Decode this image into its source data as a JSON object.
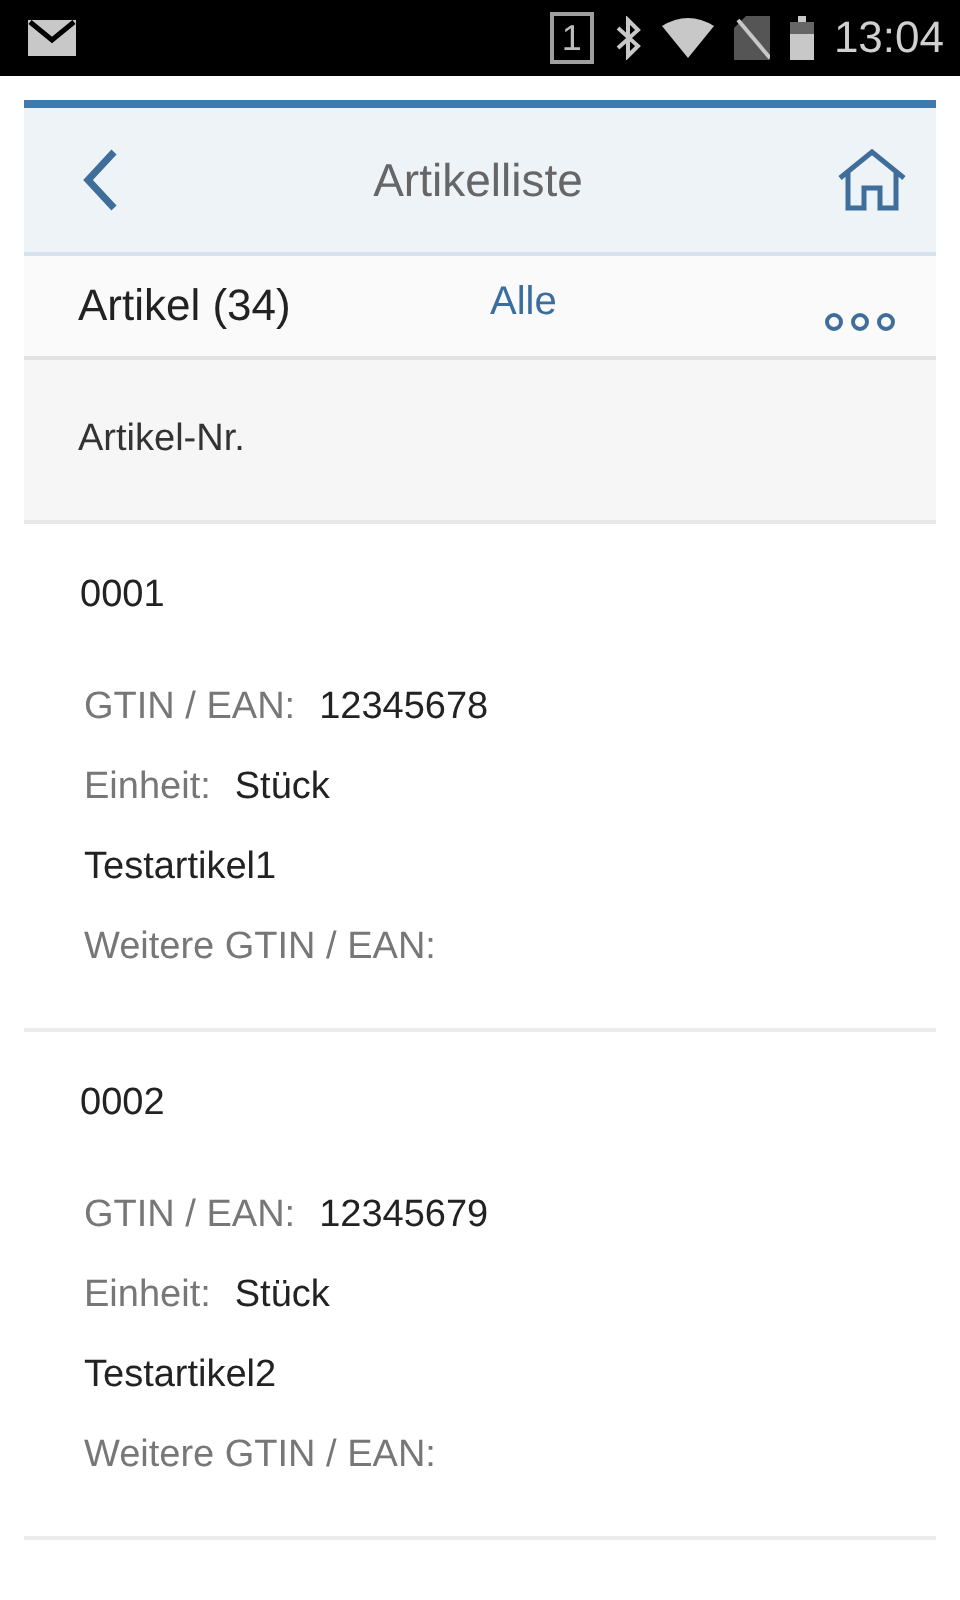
{
  "status_bar": {
    "sim": "1",
    "time": "13:04"
  },
  "header": {
    "title": "Artikelliste"
  },
  "list_header": {
    "title": "Artikel (34)",
    "filter": "Alle"
  },
  "column_header": "Artikel-Nr.",
  "items": [
    {
      "number": "0001",
      "gtin_label": "GTIN / EAN:",
      "gtin": "12345678",
      "unit_label": "Einheit:",
      "unit": "Stück",
      "name": "Testartikel1",
      "more_label": "Weitere GTIN / EAN:"
    },
    {
      "number": "0002",
      "gtin_label": "GTIN / EAN:",
      "gtin": "12345679",
      "unit_label": "Einheit:",
      "unit": "Stück",
      "name": "Testartikel2",
      "more_label": "Weitere GTIN / EAN:"
    }
  ]
}
